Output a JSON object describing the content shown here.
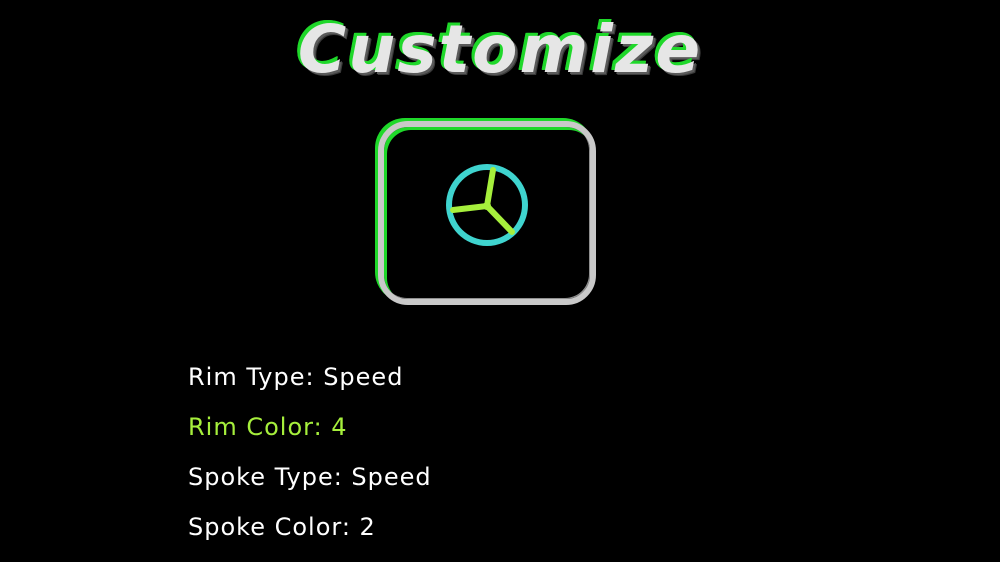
{
  "screen_title": "Customize",
  "preview": {
    "icon": "wheel-icon",
    "rim_color": "#3fd4cf",
    "spoke_color": "#a6ef3c",
    "frame_color": "#c9c9c9",
    "accent_color": "#1fd82a"
  },
  "options": [
    {
      "label": "Rim Type",
      "value": "Speed",
      "text": "Rim Type: Speed",
      "selected": false
    },
    {
      "label": "Rim Color",
      "value": "4",
      "text": "Rim Color: 4",
      "selected": true
    },
    {
      "label": "Spoke Type",
      "value": "Speed",
      "text": "Spoke Type: Speed",
      "selected": false
    },
    {
      "label": "Spoke Color",
      "value": "2",
      "text": "Spoke Color: 2",
      "selected": false
    }
  ],
  "colors": {
    "background": "#000000",
    "text": "#ffffff",
    "highlight": "#a6ef3c"
  }
}
